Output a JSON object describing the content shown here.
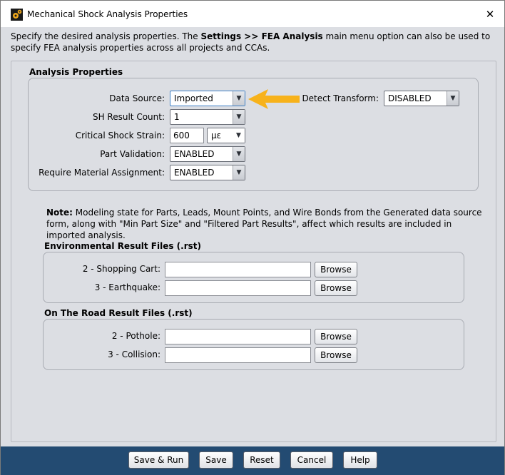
{
  "window": {
    "title": "Mechanical Shock Analysis Properties",
    "close_glyph": "✕"
  },
  "intro": {
    "text_before": "Specify the desired analysis properties. The ",
    "bold": "Settings >> FEA Analysis",
    "text_after": " main menu option can also be used to specify FEA analysis properties across all projects and CCAs."
  },
  "analysis": {
    "group_title": "Analysis Properties",
    "data_source": {
      "label": "Data Source:",
      "value": "Imported"
    },
    "detect_transform": {
      "label": "Detect Transform:",
      "value": "DISABLED"
    },
    "sh_result_count": {
      "label": "SH Result Count:",
      "value": "1"
    },
    "critical_shock_strain": {
      "label": "Critical Shock Strain:",
      "value": "600",
      "unit": "µε"
    },
    "part_validation": {
      "label": "Part Validation:",
      "value": "ENABLED"
    },
    "require_material": {
      "label": "Require Material Assignment:",
      "value": "ENABLED"
    }
  },
  "note": {
    "bold": "Note:",
    "text": " Modeling state for Parts, Leads, Mount Points, and Wire Bonds from the Generated data source form, along with \"Min Part Size\" and \"Filtered Part Results\", affect which results are included in imported analysis."
  },
  "environmental": {
    "group_title": "Environmental Result Files (.rst)",
    "rows": [
      {
        "label": "2 - Shopping Cart:",
        "value": "",
        "button": "Browse"
      },
      {
        "label": "3 - Earthquake:",
        "value": "",
        "button": "Browse"
      }
    ]
  },
  "on_the_road": {
    "group_title": "On The Road Result Files (.rst)",
    "rows": [
      {
        "label": "2 - Pothole:",
        "value": "",
        "button": "Browse"
      },
      {
        "label": "3 - Collision:",
        "value": "",
        "button": "Browse"
      }
    ]
  },
  "footer": {
    "save_run": "Save & Run",
    "save": "Save",
    "reset": "Reset",
    "cancel": "Cancel",
    "help": "Help"
  },
  "colors": {
    "footer_bg": "#234b72",
    "annotation_arrow": "#f7b21b"
  }
}
